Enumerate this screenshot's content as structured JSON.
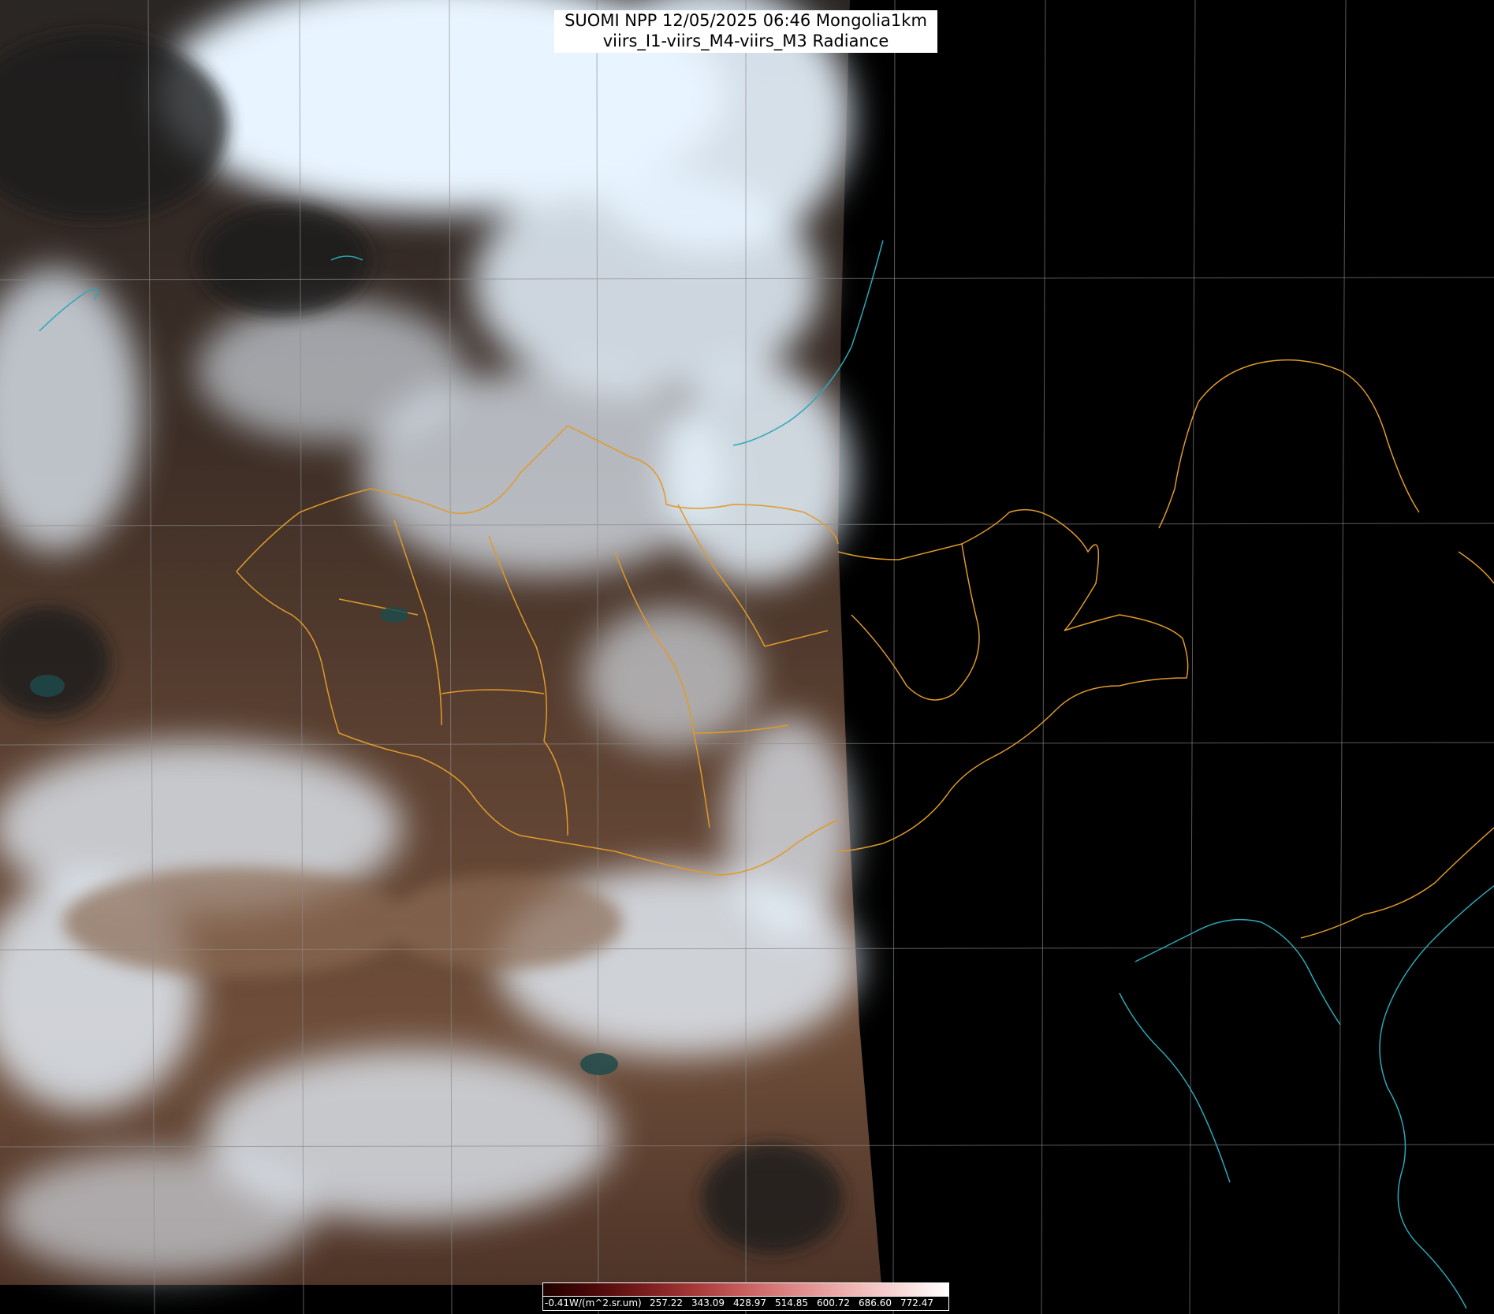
{
  "title": {
    "line1": "SUOMI NPP 12/05/2025 06:46 Mongolia1km",
    "line2": "viirs_I1-viirs_M4-viirs_M3 Radiance"
  },
  "colorbar": {
    "labels": [
      "-0.41W/(m^2.sr.um)",
      "257.22",
      "343.09",
      "428.97",
      "514.85",
      "600.72",
      "686.60",
      "772.47"
    ]
  },
  "colors": {
    "border_lines": "#e09a2a",
    "coast_lines": "#2aa8b8",
    "grid_lines": "#8a8a8a",
    "no_data": "#000000"
  }
}
